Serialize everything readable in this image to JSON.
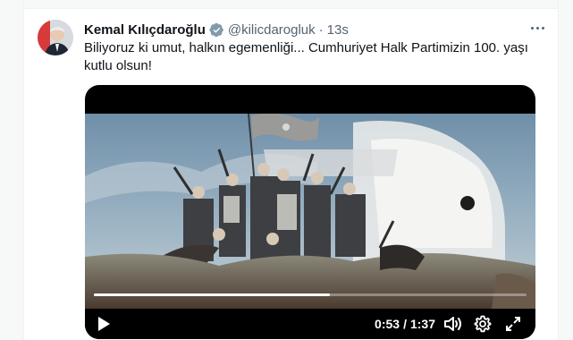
{
  "tweet": {
    "author_name": "Kemal Kılıçdaroğlu",
    "handle": "@kilicdarogluk",
    "separator": "·",
    "time": "13s",
    "verified": true,
    "text": "Biliyoruz ki umut, halkın egemenliği... Cumhuriyet Halk Partimizin 100. yaşı kutlu olsun!"
  },
  "video": {
    "current_time": "0:53",
    "time_separator": "/",
    "duration": "1:37",
    "progress_fraction": 0.546,
    "icons": [
      "play-icon",
      "volume-icon",
      "gear-icon",
      "fullscreen-icon"
    ]
  },
  "colors": {
    "verified_badge": "#829aab",
    "text_primary": "#0f1419",
    "text_secondary": "#536471",
    "video_bg": "#000000"
  }
}
